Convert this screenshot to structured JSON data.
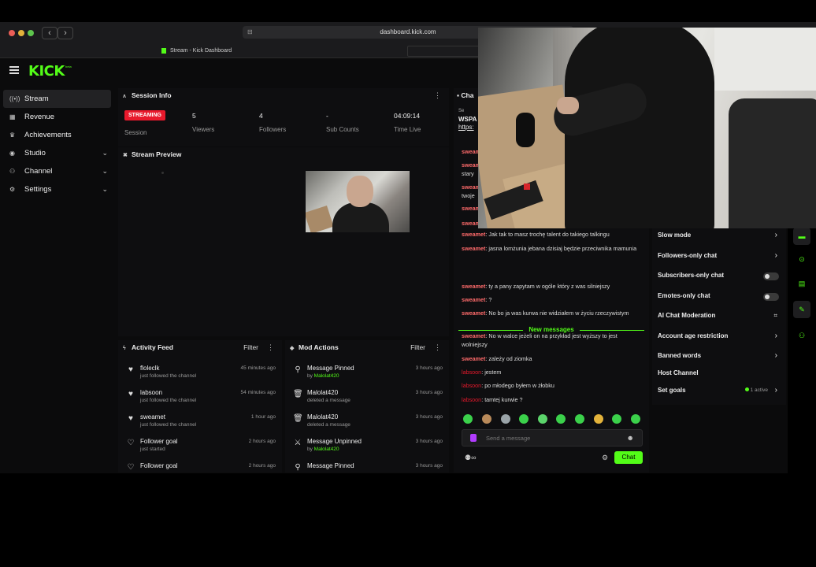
{
  "browser": {
    "url": "dashboard.kick.com",
    "tab_title": "Stream - Kick Dashboard"
  },
  "app": {
    "logo": "KICK",
    "logo_badge": "beta"
  },
  "sidebar": {
    "items": [
      {
        "label": "Stream",
        "icon": "broadcast-icon",
        "active": true
      },
      {
        "label": "Revenue",
        "icon": "revenue-icon"
      },
      {
        "label": "Achievements",
        "icon": "trophy-icon"
      },
      {
        "label": "Studio",
        "icon": "studio-icon",
        "expandable": true
      },
      {
        "label": "Channel",
        "icon": "channel-icon",
        "expandable": true
      },
      {
        "label": "Settings",
        "icon": "gear-icon",
        "expandable": true
      }
    ]
  },
  "session": {
    "title": "Session Info",
    "badge": "STREAMING",
    "session_label": "Session",
    "stats": [
      {
        "value": "5",
        "label": "Viewers"
      },
      {
        "value": "4",
        "label": "Followers"
      },
      {
        "value": "-",
        "label": "Sub Counts"
      },
      {
        "value": "04:09:14",
        "label": "Time Live"
      }
    ]
  },
  "preview": {
    "title": "Stream Preview"
  },
  "activity": {
    "title": "Activity Feed",
    "filter": "Filter",
    "items": [
      {
        "name": "floleclk",
        "sub": "just followed the channel",
        "time": "45 minutes ago",
        "icon": "heart-icon"
      },
      {
        "name": "labsoon",
        "sub": "just followed the channel",
        "time": "54 minutes ago",
        "icon": "heart-icon"
      },
      {
        "name": "sweamet",
        "sub": "just followed the channel",
        "time": "1 hour ago",
        "icon": "heart-icon"
      },
      {
        "name": "Follower goal",
        "sub": "just started",
        "time": "2 hours ago",
        "icon": "heart-outline-icon"
      },
      {
        "name": "Follower goal",
        "sub": "",
        "time": "2 hours ago",
        "icon": "heart-outline-icon"
      }
    ]
  },
  "mod_actions": {
    "title": "Mod Actions",
    "filter": "Filter",
    "items": [
      {
        "name": "Message Pinned",
        "by": "by ",
        "byuser": "Malolat420",
        "time": "3 hours ago",
        "icon": "pin-icon"
      },
      {
        "name": "Malolat420",
        "by": "deleted a message",
        "byuser": "",
        "time": "3 hours ago",
        "icon": "trash-icon"
      },
      {
        "name": "Malolat420",
        "by": "deleted a message",
        "byuser": "",
        "time": "3 hours ago",
        "icon": "trash-icon"
      },
      {
        "name": "Message Unpinned",
        "by": "by ",
        "byuser": "Malolat420",
        "time": "3 hours ago",
        "icon": "unpin-icon"
      },
      {
        "name": "Message Pinned",
        "by": "",
        "byuser": "",
        "time": "3 hours ago",
        "icon": "pin-icon"
      }
    ]
  },
  "chat": {
    "tab": "Cha",
    "pinned_tag": "Se",
    "pinned_title": "WSPA",
    "pinned_link": "https:",
    "partial_messages": [
      {
        "user": "sweam",
        "text": ""
      },
      {
        "user": "sweam",
        "text": "stary"
      },
      {
        "user": "sweam",
        "text": "twoje"
      },
      {
        "user": "sweam",
        "text": ""
      },
      {
        "user": "sweam",
        "text": ""
      }
    ],
    "messages": [
      {
        "user": "sweamet",
        "text": "Jak tak to masz trochę talent do takiego talkingu"
      },
      {
        "user": "sweamet",
        "text": "jasna lomżunia jebana dzisiaj będzie przeciwnika mamunia"
      },
      {
        "user": "sweamet",
        "text": "ty a pany zapytam w ogóle który z was silniejszy"
      },
      {
        "user": "sweamet",
        "text": "?"
      },
      {
        "user": "sweamet",
        "text": "No bo ja was kurwa nie widziałem w życiu rzeczywistym"
      },
      {
        "user": "sweamet",
        "text": "No w walce jeżeli on na przykład jest wyższy to jest wolniejszy"
      },
      {
        "user": "sweamet",
        "text": "zależy od ziomka"
      },
      {
        "user": "labsoon",
        "text": "jestem"
      },
      {
        "user": "labsoon",
        "text": "po młodego byłem w żłobku"
      },
      {
        "user": "labsoon",
        "text": "tamtej kurwie ?"
      }
    ],
    "new_messages": "New messages",
    "input_placeholder": "Send a message",
    "send_button": "Chat"
  },
  "chat_settings": {
    "items": [
      {
        "label": "Slow mode",
        "control": "chevron"
      },
      {
        "label": "Followers-only chat",
        "control": "chevron"
      },
      {
        "label": "Subscribers-only chat",
        "control": "toggle"
      },
      {
        "label": "Emotes-only chat",
        "control": "toggle"
      },
      {
        "label": "AI Chat Moderation",
        "control": "chart"
      },
      {
        "label": "Account age restriction",
        "control": "chevron"
      },
      {
        "label": "Banned words",
        "control": "chevron"
      },
      {
        "label": "Host Channel",
        "control": "none"
      },
      {
        "label": "Set goals",
        "control": "chevron",
        "extra": "1 active"
      }
    ]
  },
  "colors": {
    "brand": "#53fc18",
    "live": "#e8192c",
    "chat_user": "#ff6b6b"
  }
}
